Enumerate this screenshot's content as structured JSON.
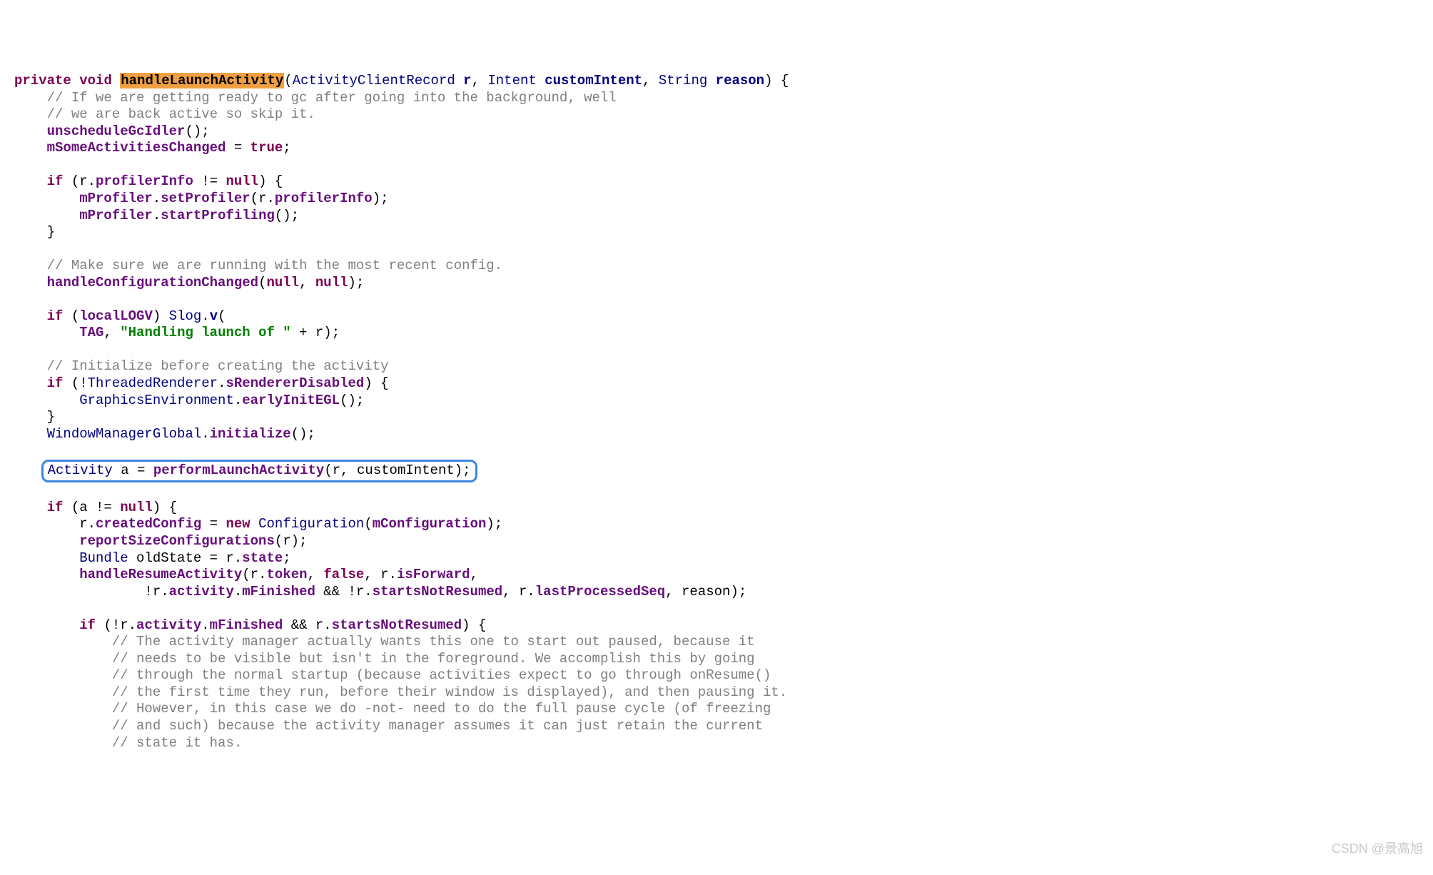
{
  "sig": {
    "kwPrivate": "private",
    "kwVoid": "void",
    "name": "handleLaunchActivity",
    "paramType1": "ActivityClientRecord",
    "paramName1": "r",
    "paramType2": "Intent",
    "paramName2": "customIntent",
    "paramType3": "String",
    "paramName3": "reason"
  },
  "c": {
    "c1": "// If we are getting ready to gc after going into the background, well",
    "c2": "// we are back active so skip it.",
    "c3": "// Make sure we are running with the most recent config.",
    "c4": "// Initialize before creating the activity",
    "c5": "// The activity manager actually wants this one to start out paused, because it",
    "c6": "// needs to be visible but isn't in the foreground. We accomplish this by going",
    "c7": "// through the normal startup (because activities expect to go through onResume()",
    "c8": "// the first time they run, before their window is displayed), and then pausing it.",
    "c9": "// However, in this case we do -not- need to do the full pause cycle (of freezing",
    "c10": "// and such) because the activity manager assumes it can just retain the current",
    "c11": "// state it has."
  },
  "m": {
    "unscheduleGcIdler": "unscheduleGcIdler",
    "mSomeActivitiesChanged": "mSomeActivitiesChanged",
    "kwTrue": "true",
    "kwIf": "if",
    "kwNew": "new",
    "kwNull": "null",
    "kwFalse": "false",
    "profilerInfo": "profilerInfo",
    "mProfiler": "mProfiler",
    "setProfiler": "setProfiler",
    "startProfiling": "startProfiling",
    "handleConfigurationChanged": "handleConfigurationChanged",
    "localLOGV": "localLOGV",
    "Slog": "Slog",
    "v": "v",
    "TAG": "TAG",
    "strHandling": "\"Handling launch of \"",
    "ThreadedRenderer": "ThreadedRenderer",
    "sRendererDisabled": "sRendererDisabled",
    "GraphicsEnvironment": "GraphicsEnvironment",
    "earlyInitEGL": "earlyInitEGL",
    "WindowManagerGlobal": "WindowManagerGlobal",
    "initialize": "initialize",
    "Activity": "Activity",
    "a": "a",
    "performLaunchActivity": "performLaunchActivity",
    "r": "r",
    "customIntent": "customIntent",
    "createdConfig": "createdConfig",
    "Configuration": "Configuration",
    "mConfiguration": "mConfiguration",
    "reportSizeConfigurations": "reportSizeConfigurations",
    "Bundle": "Bundle",
    "oldState": "oldState",
    "state": "state",
    "handleResumeActivity": "handleResumeActivity",
    "token": "token",
    "isForward": "isForward",
    "activity": "activity",
    "mFinished": "mFinished",
    "startsNotResumed": "startsNotResumed",
    "lastProcessedSeq": "lastProcessedSeq",
    "reason": "reason"
  },
  "watermark": "CSDN @景高旭"
}
